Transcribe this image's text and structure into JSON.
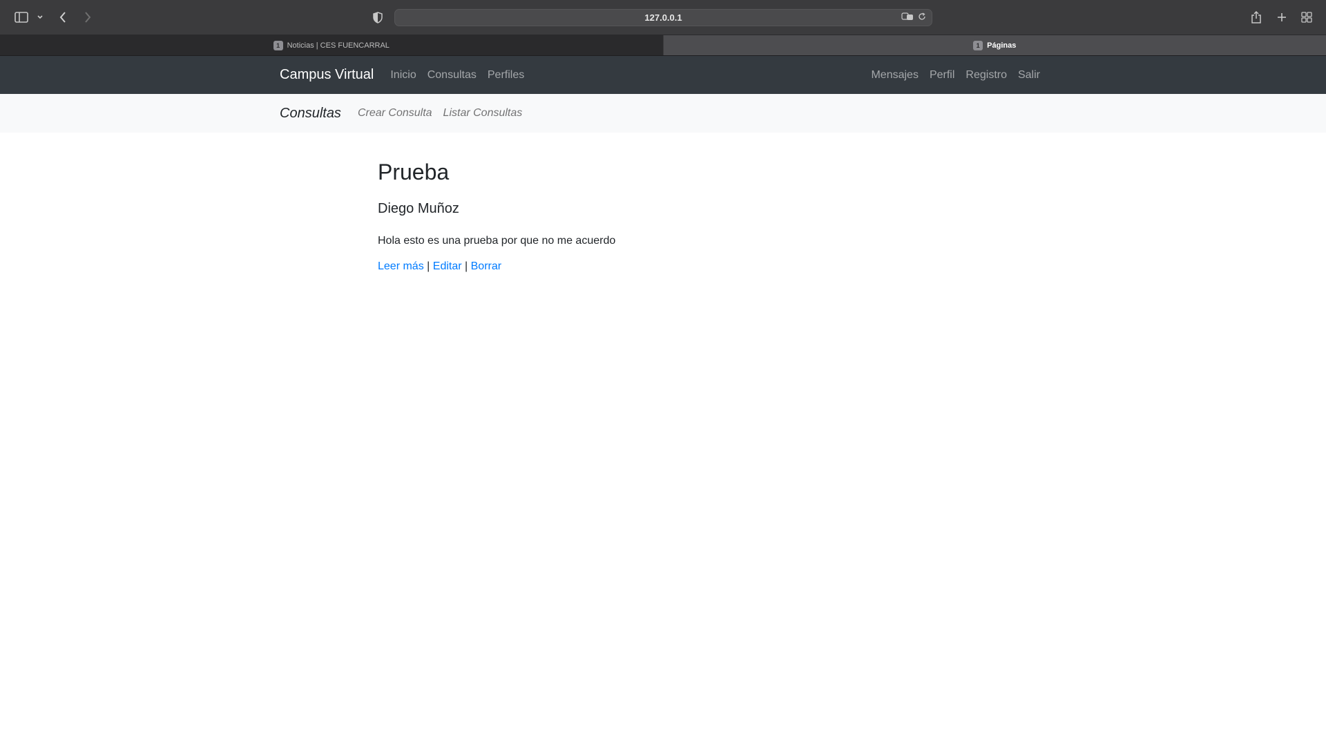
{
  "browser": {
    "url": "127.0.0.1",
    "tabs": [
      {
        "count": "1",
        "title": "Noticias | CES FUENCARRAL",
        "active": false
      },
      {
        "count": "1",
        "title": "Páginas",
        "active": true
      }
    ]
  },
  "navbar": {
    "brand": "Campus Virtual",
    "left_links": [
      "Inicio",
      "Consultas",
      "Perfiles"
    ],
    "right_links": [
      "Mensajes",
      "Perfil",
      "Registro",
      "Salir"
    ]
  },
  "subnav": {
    "brand": "Consultas",
    "links": [
      "Crear Consulta",
      "Listar Consultas"
    ]
  },
  "post": {
    "title": "Prueba",
    "author": "Diego Muñoz",
    "body": "Hola esto es una prueba por que no me acuerdo",
    "actions": {
      "read_more": "Leer más",
      "edit": "Editar",
      "delete": "Borrar",
      "separator": "|"
    }
  },
  "colors": {
    "navbar_bg": "#343a40",
    "subnav_bg": "#f8f9fa",
    "link": "#007bff"
  }
}
